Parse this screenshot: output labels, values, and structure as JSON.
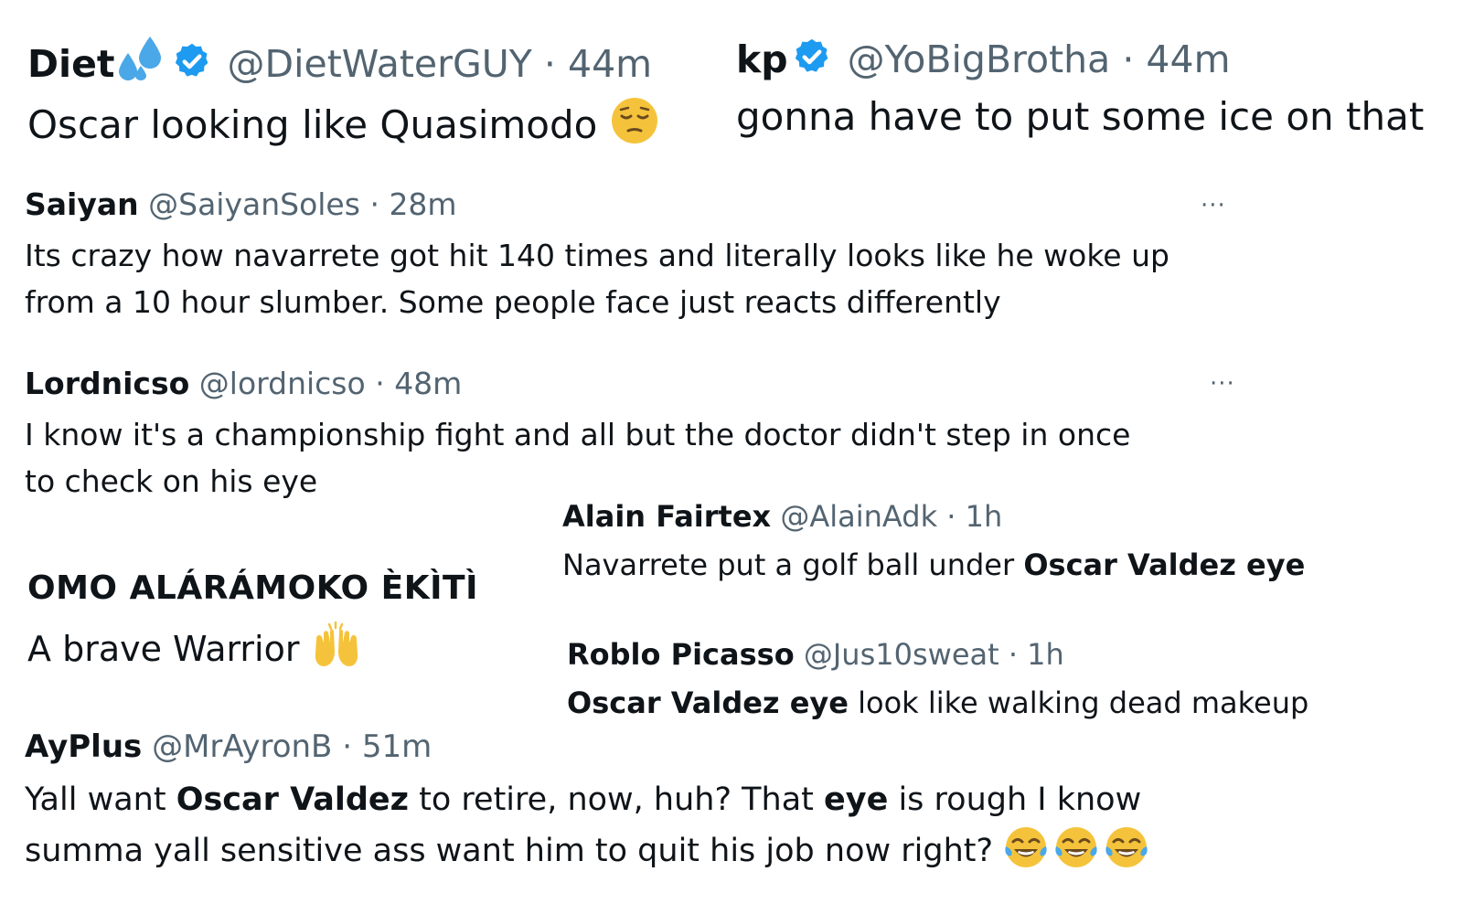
{
  "tweets": {
    "diet": {
      "name": "Diet",
      "handle": "@DietWaterGUY",
      "sep": "·",
      "time": "44m",
      "text": "Oscar looking like Quasimodo",
      "emoji": "pensive-face-emoji"
    },
    "kp": {
      "name": "kp",
      "handle": "@YoBigBrotha",
      "sep": "·",
      "time": "44m",
      "text": "gonna have to put some ice on that"
    },
    "saiyan": {
      "name": "Saiyan",
      "handle": "@SaiyanSoles",
      "sep": "·",
      "time": "28m",
      "text_line1": "Its crazy how navarrete got hit 140 times and literally looks like he woke up",
      "text_line2": "from a 10 hour slumber. Some people face just reacts differently",
      "more": "···"
    },
    "lordnicso": {
      "name": "Lordnicso",
      "handle": "@lordnicso",
      "sep": "·",
      "time": "48m",
      "text_line1": "I know it's a championship fight and all but the doctor didn't step in once",
      "text_line2": "to check on his eye",
      "more": "···"
    },
    "alain": {
      "name": "Alain Fairtex",
      "handle": "@AlainAdk",
      "sep": "·",
      "time": "1h",
      "text_pre": "Navarrete put a golf ball under ",
      "text_bold": "Oscar Valdez eye"
    },
    "omo": {
      "name": "OMO ALÁRÁMOKO ÈKÌTÌ",
      "text": "A brave Warrior",
      "emoji": "raising-hands-emoji"
    },
    "roblo": {
      "name": "Roblo Picasso",
      "handle": "@Jus10sweat",
      "sep": "·",
      "time": "1h",
      "text_bold": "Oscar Valdez eye",
      "text_post": " look like walking dead makeup"
    },
    "ayplus": {
      "name": "AyPlus",
      "handle": "@MrAyronB",
      "sep": "·",
      "time": "51m",
      "l1_a": "Yall want ",
      "l1_b": "Oscar Valdez",
      "l1_c": " to retire, now, huh? That ",
      "l1_d": "eye",
      "l1_e": " is rough I know",
      "l2": "summa yall sensitive ass want him to quit his job now right? ",
      "emoji": "tears-of-joy-emoji"
    }
  },
  "colors": {
    "text": "#0f1419",
    "secondary": "#536471",
    "verified": "#1d9bf0",
    "droplets": "#4aa8e8",
    "emoji_yellow": "#f5c33b"
  }
}
